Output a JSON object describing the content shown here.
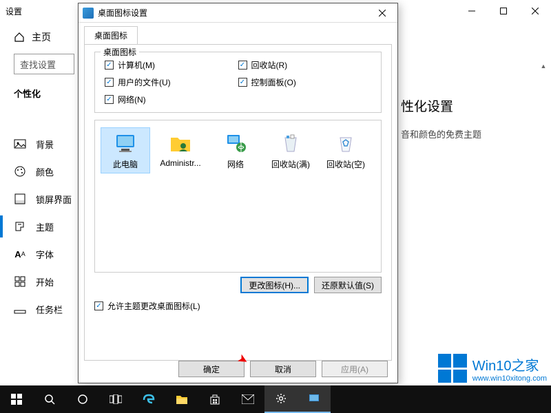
{
  "settings": {
    "title": "设置",
    "home": "主页",
    "search_placeholder": "查找设置",
    "category": "个性化",
    "nav": [
      {
        "label": "背景"
      },
      {
        "label": "颜色"
      },
      {
        "label": "锁屏界面"
      },
      {
        "label": "主题"
      },
      {
        "label": "字体"
      },
      {
        "label": "开始"
      },
      {
        "label": "任务栏"
      }
    ],
    "right_heading": "性化设置",
    "right_text": "音和颜色的免费主题"
  },
  "dialog": {
    "title": "桌面图标设置",
    "tab": "桌面图标",
    "group_label": "桌面图标",
    "checkboxes": {
      "computer": "计算机(M)",
      "userfiles": "用户的文件(U)",
      "network": "网络(N)",
      "recycle": "回收站(R)",
      "control": "控制面板(O)"
    },
    "icons": [
      {
        "label": "此电脑"
      },
      {
        "label": "Administr..."
      },
      {
        "label": "网络"
      },
      {
        "label": "回收站(满)"
      },
      {
        "label": "回收站(空)"
      }
    ],
    "change_icon": "更改图标(H)...",
    "restore_default": "还原默认值(S)",
    "allow_theme": "允许主题更改桌面图标(L)",
    "ok": "确定",
    "cancel": "取消",
    "apply": "应用(A)"
  },
  "watermark": {
    "title": "Win10之家",
    "url": "www.win10xitong.com"
  }
}
